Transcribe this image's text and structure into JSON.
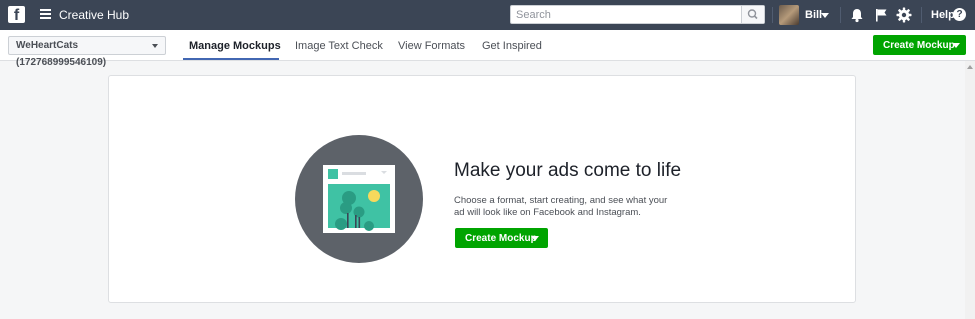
{
  "header": {
    "logo_letter": "f",
    "app_title": "Creative Hub",
    "search": {
      "placeholder": "Search",
      "value": ""
    },
    "user": {
      "name": "Bill"
    },
    "help_label": "Help",
    "help_glyph": "?"
  },
  "nav": {
    "account_label": "WeHeartCats (172768999546109)",
    "tabs": [
      {
        "label": "Manage Mockups",
        "active": true
      },
      {
        "label": "Image Text Check",
        "active": false
      },
      {
        "label": "View Formats",
        "active": false
      },
      {
        "label": "Get Inspired",
        "active": false
      }
    ],
    "create_button_label": "Create Mockup"
  },
  "empty_state": {
    "headline": "Make your ads come to life",
    "description": "Choose a format, start creating, and see what your ad will look like on Facebook and Instagram.",
    "create_button_label": "Create Mockup"
  },
  "icons": {
    "logo": "facebook-logo-icon",
    "menu": "hamburger-menu-icon",
    "search": "search-icon",
    "notifications": "bell-icon",
    "flag": "flag-icon",
    "settings": "gear-icon",
    "help": "question-circle-icon",
    "dropdown": "chevron-down-icon"
  },
  "colors": {
    "topbar": "#3b4555",
    "accent_green": "#00a400",
    "active_tab_underline": "#4267b2",
    "illustration_circle": "#5d6269",
    "illustration_teal": "#3fc2a4"
  }
}
